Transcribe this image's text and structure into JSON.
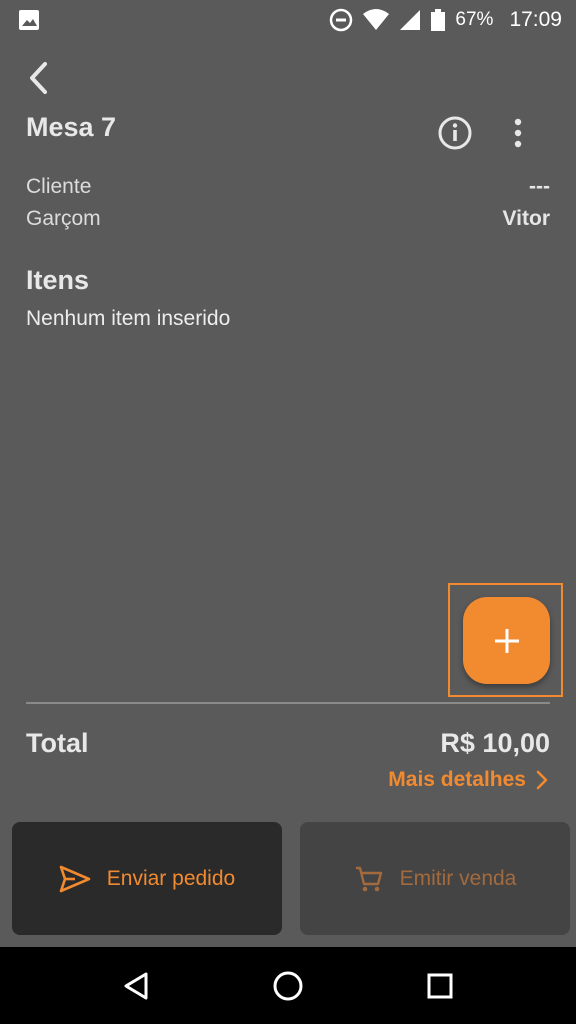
{
  "status_bar": {
    "battery": "67%",
    "time": "17:09",
    "icons": [
      "image-icon",
      "do-not-disturb-icon",
      "wifi-icon",
      "signal-icon",
      "battery-icon"
    ]
  },
  "header": {
    "title": "Mesa 7",
    "icons": [
      "back-arrow-icon",
      "info-icon",
      "more-vert-icon"
    ]
  },
  "info": {
    "cliente_label": "Cliente",
    "cliente_value": "---",
    "garcom_label": "Garçom",
    "garcom_value": "Vitor"
  },
  "items": {
    "title": "Itens",
    "empty_text": "Nenhum item inserido"
  },
  "fab": {
    "icon": "plus-icon"
  },
  "summary": {
    "total_label": "Total",
    "total_value": "R$ 10,00",
    "details_link": "Mais detalhes"
  },
  "actions": {
    "send_label": "Enviar pedido",
    "sale_label": "Emitir venda"
  },
  "colors": {
    "accent": "#f28a30",
    "background": "#5a5a5a",
    "send_button_bg": "#2a2a2a",
    "sale_button_bg": "#444444"
  },
  "nav": {
    "icons": [
      "nav-back-icon",
      "nav-home-icon",
      "nav-recents-icon"
    ]
  }
}
